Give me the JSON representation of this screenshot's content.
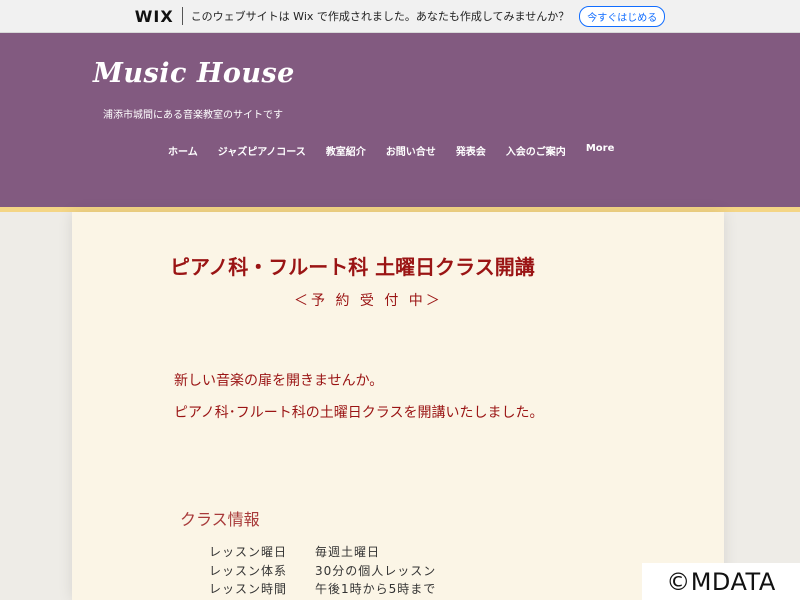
{
  "wix_banner": {
    "logo": "WIX",
    "message": "このウェブサイトは Wix で作成されました。あなたも作成してみませんか？",
    "cta": "今すぐはじめる"
  },
  "header": {
    "title": "Music House",
    "subtitle": "浦添市城間にある音楽教室のサイトです",
    "nav": [
      "ホーム",
      "ジャズピアノコース",
      "教室紹介",
      "お問い合せ",
      "発表会",
      "入会のご案内",
      "More"
    ]
  },
  "content": {
    "headline": "ピアノ科・フルート科 土曜日クラス開講",
    "reserve": "＜予 約 受 付 中＞",
    "intro": [
      "新しい音楽の扉を開きませんか。",
      "ピアノ科･フルート科の土曜日クラスを開講いたしました。"
    ],
    "class_info_title": "クラス情報",
    "class_info": [
      {
        "label": "レッスン曜日",
        "value": "毎週土曜日"
      },
      {
        "label": "レッスン体系",
        "value": "30分の個人レッスン"
      },
      {
        "label": "レッスン時間",
        "value": "午後1時から5時まで"
      }
    ]
  },
  "watermark": "©MDATA",
  "colors": {
    "header_bg": "#825a80",
    "header_border": "#f4d585",
    "panel_bg": "#fbf5e6",
    "accent_red": "#9a1414",
    "wix_blue": "#116dff"
  }
}
